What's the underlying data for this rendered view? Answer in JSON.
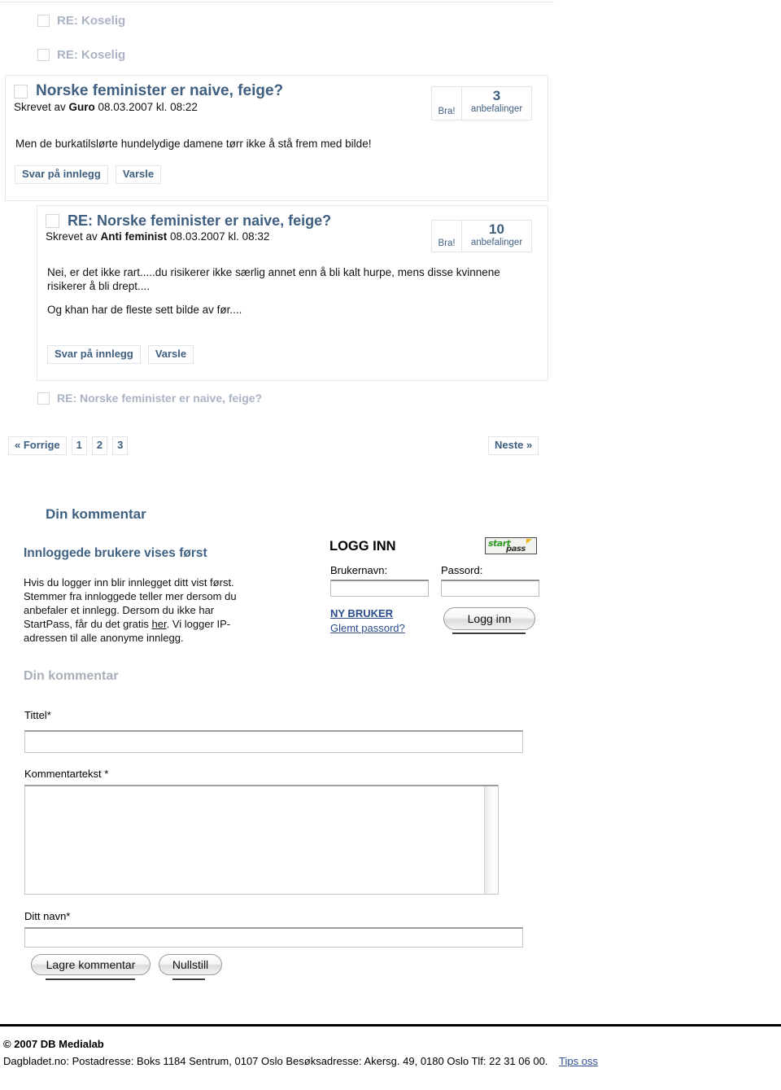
{
  "thread_links_top": [
    {
      "label": "RE: Koselig"
    },
    {
      "label": "RE: Koselig"
    }
  ],
  "posts": [
    {
      "title": "Norske feminister er naive, feige?",
      "meta_prefix": "Skrevet av ",
      "author": "Guro",
      "meta_suffix": " 08.03.2007 kl. 08:22",
      "body": [
        "Men de burkatilslørte hundelydige damene tørr ikke å stå frem med bilde!"
      ],
      "bra_label": "Bra!",
      "rec_count": "3",
      "rec_label": "anbefalinger",
      "reply_button": "Svar på innlegg",
      "notify_button": "Varsle"
    },
    {
      "title": "RE: Norske feminister er naive, feige?",
      "meta_prefix": "Skrevet av ",
      "author": "Anti feminist",
      "meta_suffix": " 08.03.2007 kl. 08:32",
      "body": [
        "Nei, er det ikke rart.....du risikerer ikke særlig annet enn å bli kalt hurpe, mens disse kvinnene risikerer å bli drept....",
        "Og khan har de fleste sett bilde av før...."
      ],
      "bra_label": "Bra!",
      "rec_count": "10",
      "rec_label": "anbefalinger",
      "reply_button": "Svar på innlegg",
      "notify_button": "Varsle"
    }
  ],
  "thread_link_bottom": {
    "label": "RE: Norske feminister er naive, feige?"
  },
  "pagination": {
    "prev": "« Forrige",
    "pages": [
      "1",
      "2",
      "3"
    ],
    "next": "Neste »"
  },
  "comment_section": {
    "heading": "Din kommentar",
    "logged_in_heading": "Innloggede brukere vises først",
    "info_part1": "Hvis du logger inn blir innlegget ditt vist først. Stemmer fra innloggede teller mer dersom du anbefaler et innlegg. Dersom du ikke har StartPass, får du det gratis ",
    "info_link": "her",
    "info_part2": ". Vi logger IP-adressen til alle anonyme innlegg."
  },
  "login": {
    "title": "LOGG INN",
    "username_label": "Brukernavn:",
    "username_value": "",
    "password_label": "Passord:",
    "password_value": "",
    "new_user_link": "NY BRUKER",
    "forgot_link": "Glemt passord?",
    "submit_label": "Logg inn",
    "logo_top": "start",
    "logo_bottom": "pass"
  },
  "form": {
    "heading": "Din kommentar",
    "title_label": "Tittel*",
    "title_value": "",
    "comment_label": "Kommentartekst *",
    "comment_value": "",
    "name_label": "Ditt navn*",
    "name_value": "",
    "save_button": "Lagre kommentar",
    "reset_button": "Nullstill"
  },
  "footer": {
    "copyright": "© 2007 DB Medialab",
    "address_line": "Dagbladet.no:  Postadresse: Boks 1184 Sentrum, 0107 Oslo   Besøksadresse: Akersg. 49, 0180 Oslo    Tlf: 22 31 06 00.",
    "tips_link": "Tips oss"
  },
  "colors": {
    "link_blue": "#3f5f80",
    "muted_link": "#aab4c4",
    "heading_blue": "#3f6182",
    "grey_heading": "#a8afb8",
    "underline_link": "#2a4b8d",
    "logo_green": "#2f9b24"
  }
}
